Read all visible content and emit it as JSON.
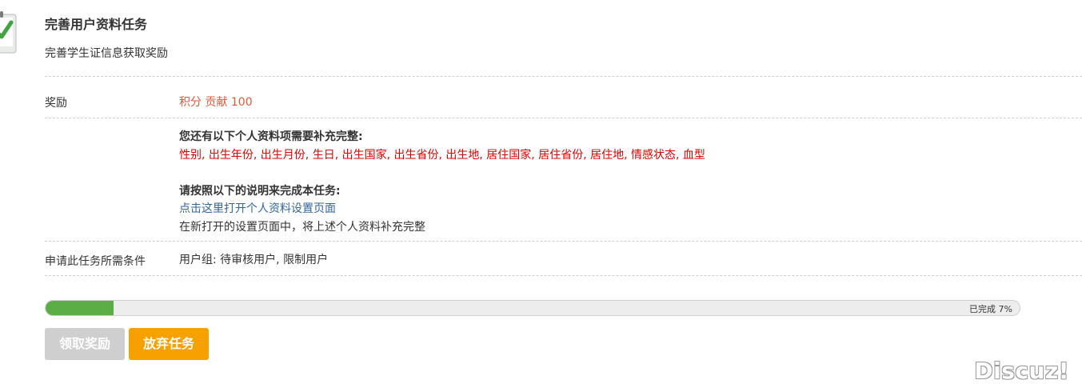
{
  "task": {
    "title": "完善用户资料任务",
    "description": "完善学生证信息获取奖励"
  },
  "reward": {
    "label": "奖励",
    "value": "积分 贡献 100"
  },
  "profile": {
    "heading": "您还有以下个人资料项需要补充完整:",
    "missing": "性别, 出生年份, 出生月份, 生日, 出生国家, 出生省份, 出生地, 居住国家, 居住省份, 居住地, 情感状态, 血型",
    "instructions_heading": "请按照以下的说明来完成本任务:",
    "link_text": "点击这里打开个人资料设置页面",
    "instruction_text": "在新打开的设置页面中，将上述个人资料补充完整"
  },
  "requirements": {
    "label": "申请此任务所需条件",
    "value": "用户组: 待审核用户, 限制用户"
  },
  "progress": {
    "percent": 7,
    "text": "已完成 7%"
  },
  "buttons": {
    "claim": "领取奖励",
    "abandon": "放弃任务"
  },
  "brand": "Discuz!",
  "colors": {
    "progress_fill": "#5aae45",
    "abandon_button": "#f7a100",
    "claim_button_disabled": "#cfcfcf",
    "reward_text": "#e05a3c",
    "missing_text": "#e00000",
    "link": "#336699"
  },
  "icons": {
    "task": "task-complete-icon"
  }
}
